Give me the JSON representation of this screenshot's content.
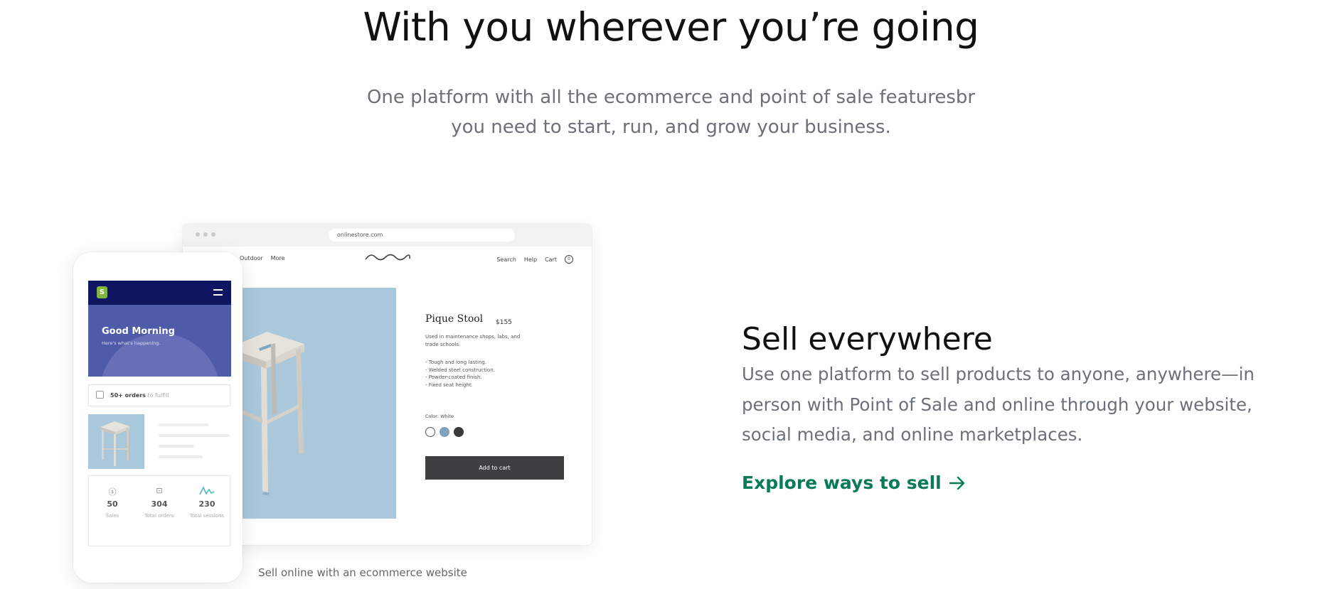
{
  "hero": {
    "title": "With you wherever you’re going",
    "subtitle_line1": "One platform with all the ecommerce and point of sale featuresbr",
    "subtitle_line2": "you need to start, run, and grow your business."
  },
  "illustration": {
    "browser": {
      "url": "onlinestore.com",
      "nav_left": [
        "Outdoor",
        "More"
      ],
      "nav_right": [
        "Search",
        "Help",
        "Cart"
      ],
      "cart_count": "0"
    },
    "product": {
      "name": "Pique Stool",
      "price": "$155",
      "description": "Used in maintenance shops, labs, and trade schools.",
      "bullets": [
        "- Tough and long lasting.",
        "- Welded steel construction.",
        "- Powder-coated finish.",
        "- Fixed seat height."
      ],
      "color_label": "Color: White",
      "swatch_colors": [
        "#ffffff",
        "#7fa3bd",
        "#3a3a3a"
      ],
      "add_to_cart": "Add to cart"
    },
    "phone": {
      "greeting": "Good Morning",
      "greeting_sub": "Here's what's happening.",
      "orders_bold": "50+ orders",
      "orders_rest": "to fulfill",
      "stats": [
        {
          "icon": "dollar-icon",
          "value": "50",
          "label": "Sales"
        },
        {
          "icon": "inbox-icon",
          "value": "304",
          "label": "Total orders"
        },
        {
          "icon": "pulse-icon",
          "value": "230",
          "label": "Total sessions"
        }
      ]
    },
    "caption": "Sell online with an ecommerce website"
  },
  "sell": {
    "title": "Sell everywhere",
    "body": "Use one platform to sell products to anyone, anywhere—in person with Point of Sale and online through your website, social media, and online marketplaces.",
    "link_label": "Explore ways to sell",
    "link_icon": "arrow-right-icon",
    "link_color": "#0a7b58"
  }
}
